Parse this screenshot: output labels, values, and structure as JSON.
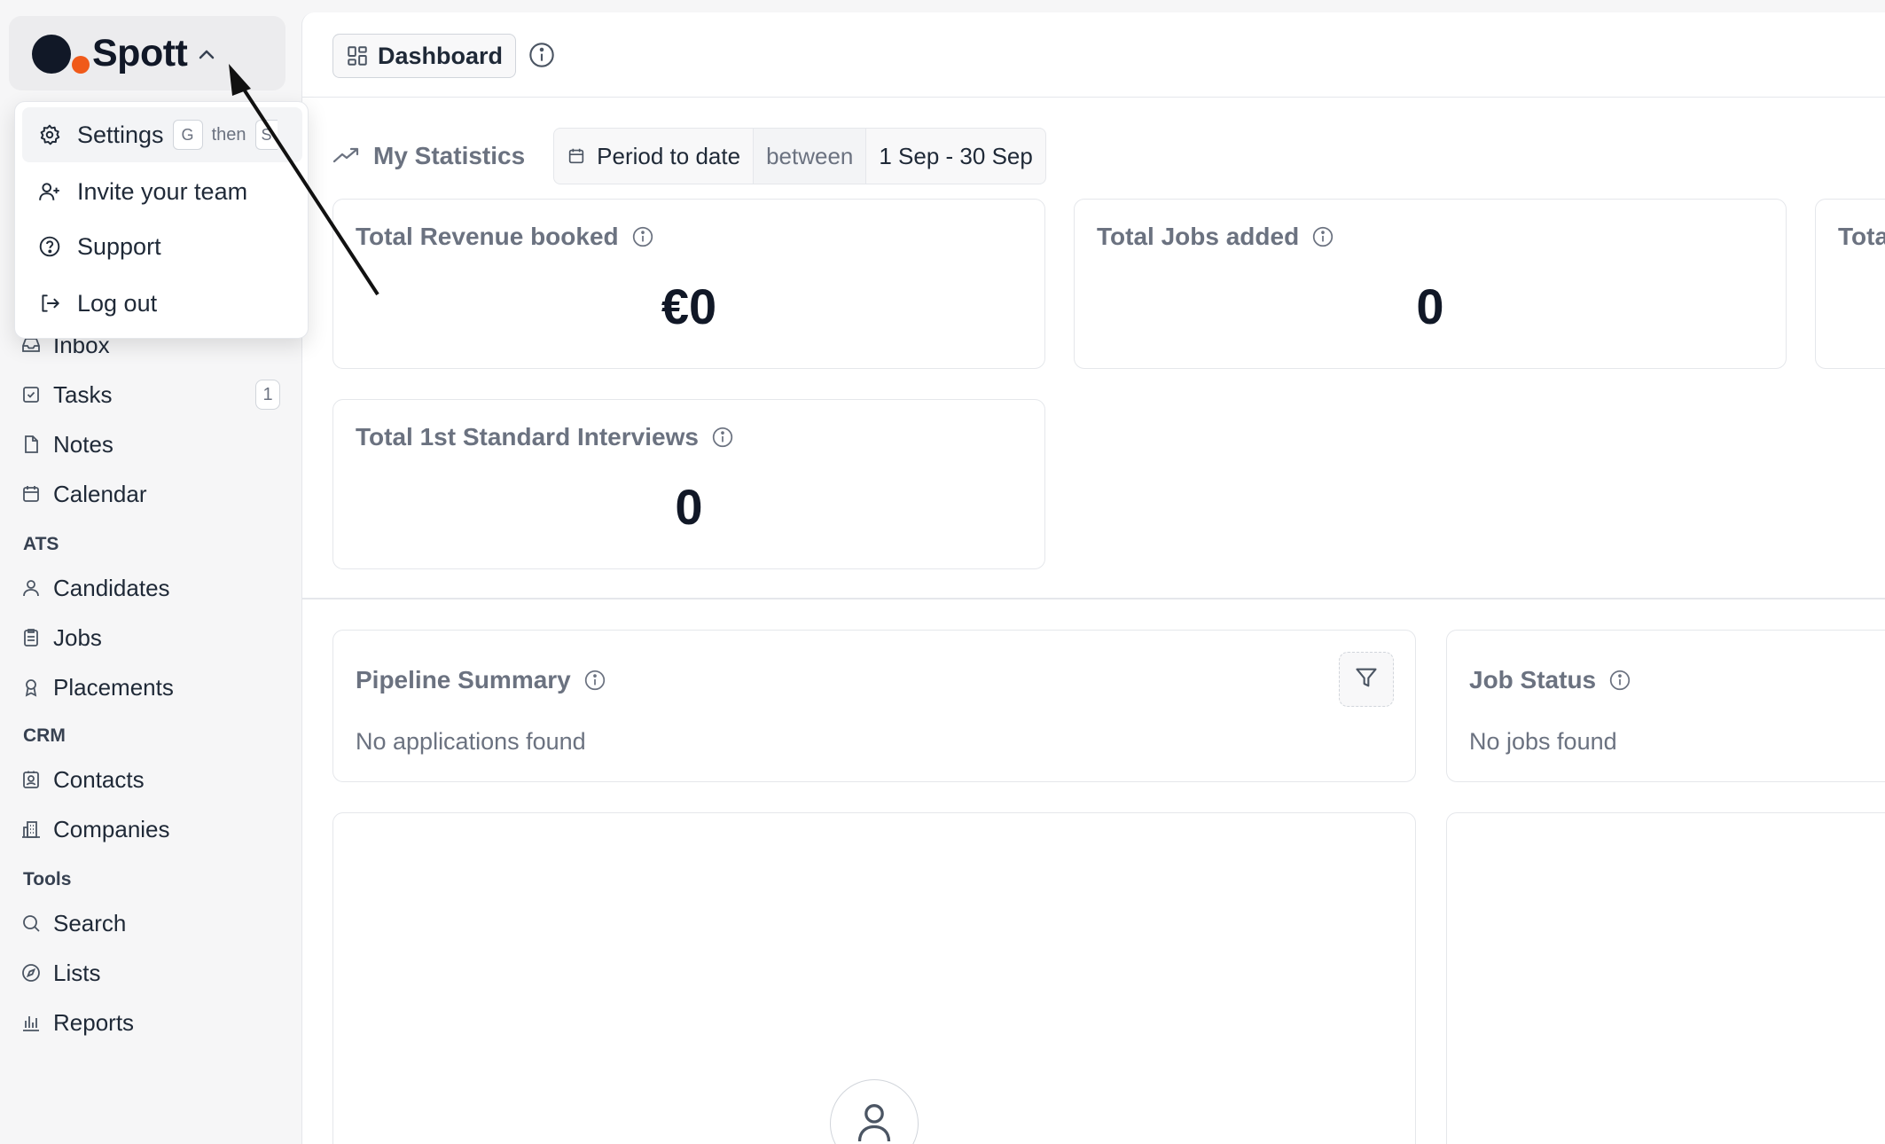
{
  "brand": {
    "name": "Spott",
    "colors": {
      "dark": "#111827",
      "accent": "#f05a1a"
    }
  },
  "menu": {
    "items": [
      {
        "label": "Settings",
        "icon": "gear-icon",
        "shortcut_keys": [
          "G",
          "S"
        ],
        "shortcut_sep": "then"
      },
      {
        "label": "Invite your team",
        "icon": "user-plus-icon"
      },
      {
        "label": "Support",
        "icon": "help-circle-icon"
      },
      {
        "label": "Log out",
        "icon": "log-out-icon"
      }
    ]
  },
  "sidebar": {
    "items": [
      {
        "label": "Inbox",
        "icon": "inbox-icon"
      },
      {
        "label": "Tasks",
        "icon": "check-square-icon",
        "badge": "1"
      },
      {
        "label": "Notes",
        "icon": "file-icon"
      },
      {
        "label": "Calendar",
        "icon": "calendar-icon"
      }
    ],
    "sections": [
      {
        "label": "ATS",
        "items": [
          {
            "label": "Candidates",
            "icon": "user-icon"
          },
          {
            "label": "Jobs",
            "icon": "clipboard-icon"
          },
          {
            "label": "Placements",
            "icon": "award-icon"
          }
        ]
      },
      {
        "label": "CRM",
        "items": [
          {
            "label": "Contacts",
            "icon": "contact-icon"
          },
          {
            "label": "Companies",
            "icon": "building-icon"
          }
        ]
      },
      {
        "label": "Tools",
        "items": [
          {
            "label": "Search",
            "icon": "search-icon"
          },
          {
            "label": "Lists",
            "icon": "compass-icon"
          },
          {
            "label": "Reports",
            "icon": "bar-chart-icon"
          }
        ]
      }
    ]
  },
  "topbar": {
    "dashboard_label": "Dashboard"
  },
  "stats": {
    "title": "My Statistics",
    "period_label": "Period to date",
    "between_label": "between",
    "range_label": "1 Sep  -  30 Sep",
    "cards": [
      {
        "title": "Total Revenue booked",
        "value": "€0"
      },
      {
        "title": "Total Jobs added",
        "value": "0"
      },
      {
        "title": "Tota",
        "value": ""
      },
      {
        "title": "Total 1st Standard Interviews",
        "value": "0"
      }
    ]
  },
  "pipeline": {
    "title": "Pipeline Summary",
    "empty": "No applications found"
  },
  "job_status": {
    "title": "Job Status",
    "empty": "No jobs found"
  }
}
